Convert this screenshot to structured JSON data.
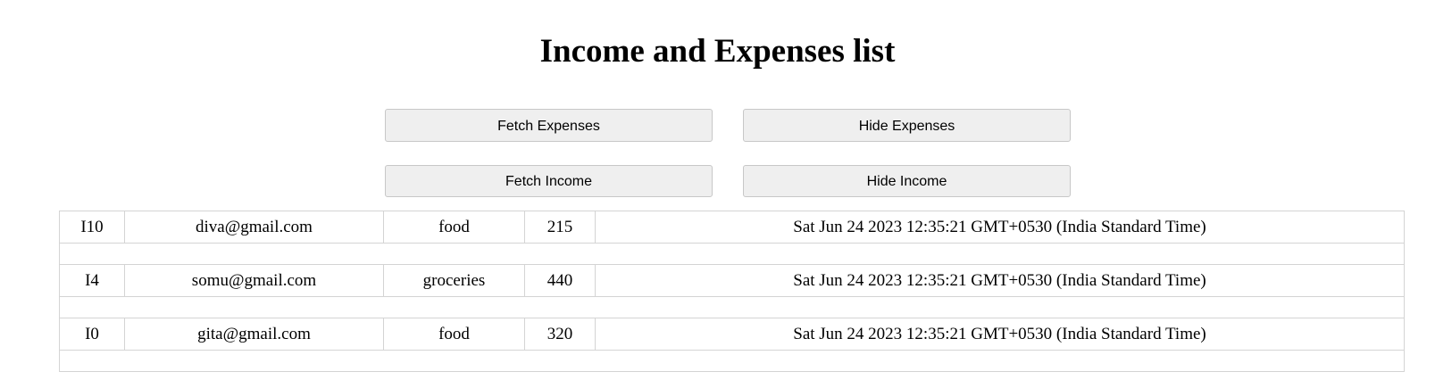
{
  "page": {
    "title": "Income and Expenses list"
  },
  "buttons": {
    "fetch_expenses": "Fetch Expenses",
    "hide_expenses": "Hide Expenses",
    "fetch_income": "Fetch Income",
    "hide_income": "Hide Income"
  },
  "rows": [
    {
      "id": "I10",
      "email": "diva@gmail.com",
      "category": "food",
      "amount": "215",
      "date": "Sat Jun 24 2023 12:35:21 GMT+0530 (India Standard Time)"
    },
    {
      "id": "I4",
      "email": "somu@gmail.com",
      "category": "groceries",
      "amount": "440",
      "date": "Sat Jun 24 2023 12:35:21 GMT+0530 (India Standard Time)"
    },
    {
      "id": "I0",
      "email": "gita@gmail.com",
      "category": "food",
      "amount": "320",
      "date": "Sat Jun 24 2023 12:35:21 GMT+0530 (India Standard Time)"
    }
  ]
}
